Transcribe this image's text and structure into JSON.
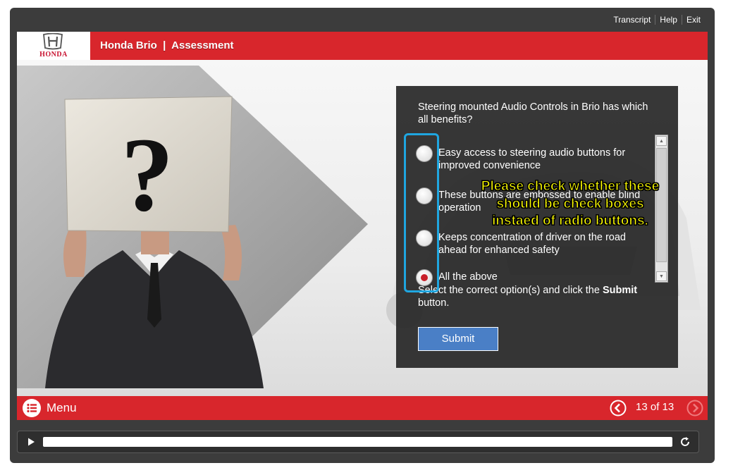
{
  "topnav": {
    "transcript": "Transcript",
    "help": "Help",
    "exit": "Exit"
  },
  "header": {
    "logo_text": "HONDA",
    "title": "Honda Brio  |  Assessment"
  },
  "question": {
    "text": "Steering mounted Audio Controls in Brio has which all benefits?",
    "options": [
      {
        "label": "Easy access to steering audio buttons for improved convenience",
        "selected": false
      },
      {
        "label": "These buttons are embossed to enable blind operation",
        "selected": false
      },
      {
        "label": "Keeps concentration of driver on the road ahead for enhanced safety",
        "selected": false
      },
      {
        "label": "All the above",
        "selected": true
      }
    ],
    "instruction_pre": "Select the correct option(s) and click the ",
    "instruction_bold": "Submit",
    "instruction_post": " button.",
    "submit_label": "Submit"
  },
  "annotation": {
    "note": "Please check whether these should be check boxes instaed of radio buttons.",
    "color": "#ffff00",
    "highlight_color": "#1fa6e0"
  },
  "footer": {
    "menu_label": "Menu",
    "page_indicator": "13 of 13"
  },
  "player": {
    "progress": 0.0
  },
  "colors": {
    "brand_red": "#d8262c",
    "panel": "#262626",
    "submit": "#4a7fc6"
  },
  "icons": [
    "honda-emblem-icon",
    "menu-list-icon",
    "prev-arrow-icon",
    "next-arrow-icon",
    "play-icon",
    "replay-icon"
  ]
}
